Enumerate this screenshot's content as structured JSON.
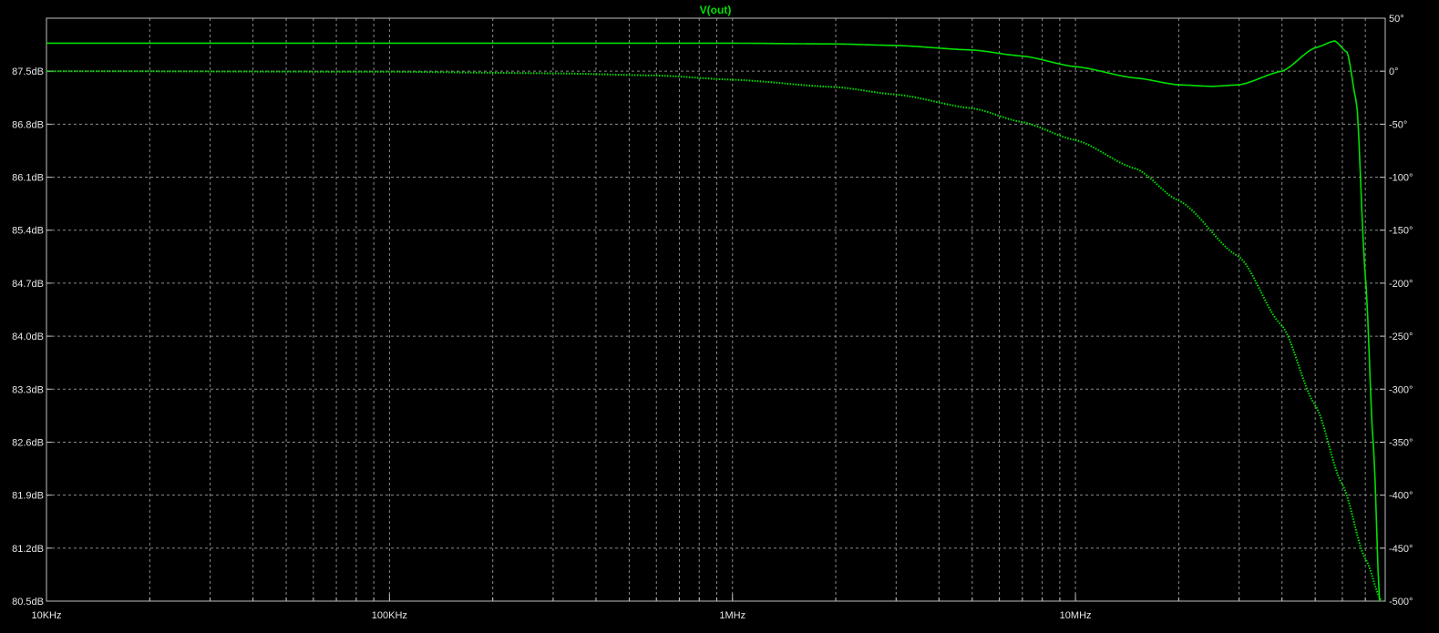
{
  "window": {
    "background": "#000000",
    "frame_color": "#c0c0c0",
    "grid_color": "#8a8a8a",
    "text_color": "#e6e6e6",
    "trace_color": "#00e000"
  },
  "chart_data": {
    "type": "line",
    "title": "V(out)",
    "x_scale": "log",
    "xlim": [
      10000,
      80000000
    ],
    "x_ticks": [
      {
        "value": 10000,
        "label": "10KHz"
      },
      {
        "value": 100000,
        "label": "100KHz"
      },
      {
        "value": 1000000,
        "label": "1MHz"
      },
      {
        "value": 10000000,
        "label": "10MHz"
      }
    ],
    "y_left": {
      "unit": "dB",
      "ylim": [
        80.5,
        88.2
      ],
      "ticks": [
        {
          "value": 87.5,
          "label": "87.5dB"
        },
        {
          "value": 86.8,
          "label": "86.8dB"
        },
        {
          "value": 86.1,
          "label": "86.1dB"
        },
        {
          "value": 85.4,
          "label": "85.4dB"
        },
        {
          "value": 84.7,
          "label": "84.7dB"
        },
        {
          "value": 84.0,
          "label": "84.0dB"
        },
        {
          "value": 83.3,
          "label": "83.3dB"
        },
        {
          "value": 82.6,
          "label": "82.6dB"
        },
        {
          "value": 81.9,
          "label": "81.9dB"
        },
        {
          "value": 81.2,
          "label": "81.2dB"
        },
        {
          "value": 80.5,
          "label": "80.5dB"
        }
      ]
    },
    "y_right": {
      "unit": "°",
      "ylim": [
        -500,
        50
      ],
      "ticks": [
        {
          "value": 50,
          "label": "50°"
        },
        {
          "value": 0,
          "label": "0°"
        },
        {
          "value": -50,
          "label": "-50°"
        },
        {
          "value": -100,
          "label": "-100°"
        },
        {
          "value": -150,
          "label": "-150°"
        },
        {
          "value": -200,
          "label": "-200°"
        },
        {
          "value": -250,
          "label": "-250°"
        },
        {
          "value": -300,
          "label": "-300°"
        },
        {
          "value": -350,
          "label": "-350°"
        },
        {
          "value": -400,
          "label": "-400°"
        },
        {
          "value": -450,
          "label": "-450°"
        },
        {
          "value": -500,
          "label": "-500°"
        }
      ]
    },
    "grid": true,
    "series": [
      {
        "axis": "left",
        "style": "solid",
        "points": [
          [
            10000,
            87.87
          ],
          [
            100000,
            87.87
          ],
          [
            1000000,
            87.87
          ],
          [
            2000000,
            87.86
          ],
          [
            3000000,
            87.84
          ],
          [
            5000000,
            87.78
          ],
          [
            7000000,
            87.7
          ],
          [
            10000000,
            87.56
          ],
          [
            15000000,
            87.41
          ],
          [
            20000000,
            87.32
          ],
          [
            25000000,
            87.3
          ],
          [
            30000000,
            87.32
          ],
          [
            40000000,
            87.5
          ],
          [
            50000000,
            87.81
          ],
          [
            57000000,
            87.9
          ],
          [
            62000000,
            87.75
          ],
          [
            66000000,
            87.1
          ],
          [
            70000000,
            84.8
          ],
          [
            74000000,
            82.5
          ],
          [
            77000000,
            80.5
          ]
        ]
      },
      {
        "axis": "right",
        "style": "dotted",
        "points": [
          [
            10000,
            0
          ],
          [
            100000,
            -0.5
          ],
          [
            300000,
            -2
          ],
          [
            600000,
            -4
          ],
          [
            1000000,
            -8
          ],
          [
            2000000,
            -15
          ],
          [
            3000000,
            -22
          ],
          [
            5000000,
            -35
          ],
          [
            7000000,
            -48
          ],
          [
            10000000,
            -65
          ],
          [
            15000000,
            -92
          ],
          [
            20000000,
            -122
          ],
          [
            30000000,
            -175
          ],
          [
            40000000,
            -240
          ],
          [
            50000000,
            -315
          ],
          [
            60000000,
            -390
          ],
          [
            70000000,
            -460
          ],
          [
            78000000,
            -500
          ]
        ]
      }
    ]
  }
}
